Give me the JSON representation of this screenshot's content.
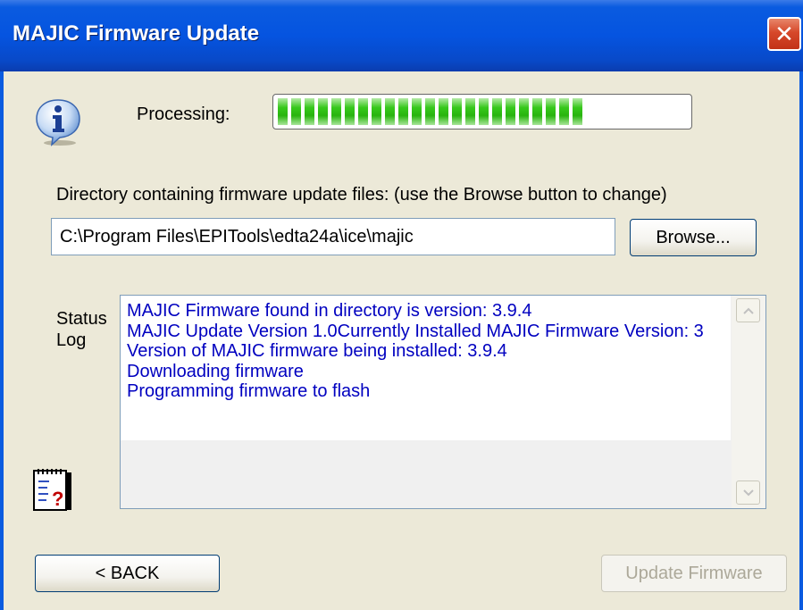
{
  "window": {
    "title": "MAJIC Firmware Update",
    "close_symbol": "✕"
  },
  "icons": {
    "info": "info-icon",
    "notepad": "notepad-help-icon"
  },
  "progress": {
    "label": "Processing:",
    "value_percent": 73
  },
  "directory": {
    "label": "Directory containing firmware update files: (use the Browse button to change)",
    "value": "C:\\Program Files\\EPITools\\edta24a\\ice\\majic",
    "browse_label": "Browse..."
  },
  "status_log": {
    "label_line1": "Status",
    "label_line2": "Log",
    "lines": [
      "MAJIC Firmware found in directory is version: 3.9.4",
      "MAJIC Update Version 1.0Currently Installed MAJIC Firmware Version: 3",
      "Version of MAJIC firmware being installed: 3.9.4",
      "Downloading firmware",
      "Programming firmware to flash"
    ]
  },
  "footer": {
    "back_label": "< BACK",
    "update_label": "Update Firmware"
  },
  "colors": {
    "titlebar": "#0554E0",
    "face": "#ECE9D8",
    "progress_green": "#28B40E",
    "log_text": "#0000C0"
  }
}
